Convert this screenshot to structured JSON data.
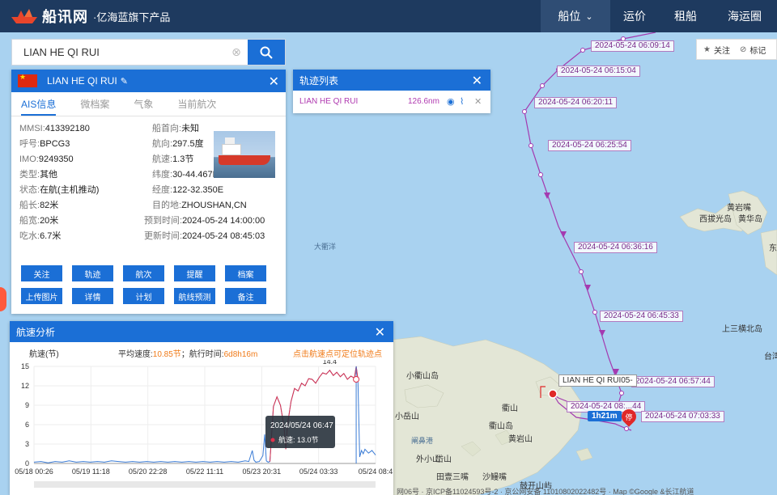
{
  "header": {
    "logo_text": "船讯网",
    "logo_sub": "·亿海蓝旗下产品",
    "nav": [
      {
        "label": "船位",
        "active": true
      },
      {
        "label": "运价",
        "active": false
      },
      {
        "label": "租船",
        "active": false
      },
      {
        "label": "海运圈",
        "active": false
      }
    ]
  },
  "search": {
    "value": "LIAN HE QI RUI"
  },
  "ship": {
    "name": "LIAN HE QI RUI",
    "tabs": [
      "AIS信息",
      "微档案",
      "气象",
      "当前航次"
    ],
    "left": [
      {
        "k": "MMSI:",
        "v": "413392180"
      },
      {
        "k": "呼号:",
        "v": "BPCG3"
      },
      {
        "k": "IMO:",
        "v": "9249350"
      },
      {
        "k": "类型:",
        "v": "其他"
      },
      {
        "k": "状态:",
        "v": "在航(主机推动)"
      },
      {
        "k": "船长:",
        "v": "82米"
      },
      {
        "k": "船宽:",
        "v": "20米"
      },
      {
        "k": "吃水:",
        "v": "6.7米"
      }
    ],
    "right": [
      {
        "k": "船首向:",
        "v": "未知"
      },
      {
        "k": "航向:",
        "v": "297.5度"
      },
      {
        "k": "航速:",
        "v": "1.3节"
      },
      {
        "k": "纬度:",
        "v": "30-44.467N"
      },
      {
        "k": "经度:",
        "v": "122-32.350E"
      },
      {
        "k": "目的地:",
        "v": "ZHOUSHAN,CN"
      },
      {
        "k": "预到时间:",
        "v": "2024-05-24 14:00:00"
      },
      {
        "k": "更新时间:",
        "v": "2024-05-24 08:45:03"
      }
    ],
    "buttons": [
      "关注",
      "轨迹",
      "航次",
      "提醒",
      "档案",
      "上传图片",
      "详情",
      "计划",
      "航线预测",
      "备注"
    ]
  },
  "track_list": {
    "title": "轨迹列表",
    "row": {
      "name": "LIAN HE QI RUI",
      "distance": "126.6nm"
    }
  },
  "speed": {
    "title": "航速分析",
    "ylabel": "航速(节)",
    "avg_label": "平均速度:",
    "avg_value": "10.85节",
    "duration_label": "；航行时间:",
    "duration_value": "6d8h16m",
    "hint": "点击航速点可定位轨迹点",
    "tooltip_time": "2024/05/24 06:47",
    "tooltip_label": "航速:",
    "tooltip_value": "13.0节",
    "peak_label": "14.4"
  },
  "chart_data": {
    "type": "line",
    "title": "航速分析",
    "ylabel": "航速(节)",
    "ylim": [
      0,
      15
    ],
    "yticks": [
      0,
      3,
      6,
      9,
      12,
      15
    ],
    "xtick_labels": [
      "05/18 00:26",
      "05/19 11:18",
      "05/20 22:28",
      "05/22 11:11",
      "05/23 20:31",
      "05/24 03:33",
      "05/24 08:4"
    ],
    "series": [
      {
        "points": [
          [
            0,
            0.2
          ],
          [
            2,
            0.3
          ],
          [
            4,
            0.1
          ],
          [
            6,
            0.3
          ],
          [
            8,
            0.2
          ],
          [
            10,
            0.4
          ],
          [
            12,
            0.2
          ],
          [
            14,
            0.3
          ],
          [
            16,
            0.2
          ],
          [
            18,
            0.3
          ],
          [
            20,
            0.2
          ],
          [
            22,
            0.4
          ],
          [
            24,
            0.3
          ],
          [
            26,
            0.2
          ],
          [
            28,
            0.3
          ],
          [
            30,
            0.2
          ],
          [
            32,
            0.3
          ],
          [
            34,
            0.2
          ],
          [
            36,
            0.3
          ],
          [
            38,
            0.2
          ],
          [
            40,
            0.3
          ],
          [
            42,
            0.2
          ],
          [
            44,
            0.3
          ],
          [
            46,
            0.2
          ],
          [
            48,
            0.3
          ],
          [
            50,
            0.2
          ],
          [
            52,
            0.3
          ],
          [
            54,
            0.2
          ],
          [
            56,
            0.3
          ],
          [
            58,
            0.2
          ],
          [
            60,
            0.4
          ],
          [
            61,
            0.3
          ],
          [
            62,
            2.0
          ],
          [
            62.5,
            0.5
          ],
          [
            63,
            0.2
          ],
          [
            64,
            0.3
          ],
          [
            65,
            1.2
          ],
          [
            65.5,
            4.5
          ],
          [
            66,
            0.4
          ],
          [
            66.5,
            0.2
          ],
          [
            67,
            0.3
          ],
          [
            68,
            8.8
          ],
          [
            69,
            10.3
          ],
          [
            70,
            9.0
          ],
          [
            71,
            5.7
          ],
          [
            71.5,
            2.2
          ],
          [
            72,
            6.0
          ],
          [
            73,
            9.6
          ],
          [
            74,
            11.6
          ],
          [
            75,
            11.2
          ],
          [
            76,
            12.4
          ],
          [
            77,
            12.0
          ],
          [
            78,
            13.1
          ],
          [
            79,
            13.0
          ],
          [
            80,
            12.4
          ],
          [
            81,
            13.3
          ],
          [
            82,
            14.0
          ],
          [
            83,
            13.8
          ],
          [
            84,
            14.4
          ],
          [
            85,
            13.6
          ],
          [
            86,
            14.1
          ],
          [
            87,
            13.4
          ],
          [
            88,
            13.9
          ],
          [
            89,
            13.0
          ],
          [
            90,
            13.5
          ],
          [
            91,
            13.2
          ],
          [
            91.5,
            15.0
          ],
          [
            92,
            13.0
          ],
          [
            92.5,
            1.0
          ],
          [
            93,
            2.0
          ],
          [
            93.5,
            1.5
          ],
          [
            94,
            2.2
          ],
          [
            95,
            1.6
          ],
          [
            96,
            2.0
          ],
          [
            97,
            1.3
          ]
        ]
      }
    ]
  },
  "map": {
    "labels": [
      "小衢山岛",
      "衢山岛",
      "田壹三嘴",
      "沙鳗嘴",
      "黄岩山",
      "衢山",
      "大衢洋",
      "小岳山",
      "阐鼻港",
      "岱山",
      "外小山",
      "鼓开山屿",
      "黄岩嘴",
      "西拔光岛",
      "黄华岛",
      "上三横北岛",
      "东",
      "台湾"
    ],
    "track_tags": [
      "2024-05-24 06:09:14",
      "2024-05-24 06:15:04",
      "2024-05-24 06:20:11",
      "2024-05-24 06:25:54",
      "2024-05-24 06:36:16",
      "2024-05-24 06:45:33",
      "2024-05-24 06:57:44",
      "2024-05-24 08:...44",
      "2024-05-24 07:03:33"
    ],
    "ship_label": "LIAN HE QI RUI",
    "ship_label_suffix": "05-",
    "duration_badge": "1h21m",
    "pin_glyph": "停"
  },
  "follow": {
    "label1": "关注",
    "label2": "标记"
  },
  "copyright": "网06号 · 京ICP备11024593号-2 · 京公网安备 11010802022482号 · Map ©Google &长江航道"
}
